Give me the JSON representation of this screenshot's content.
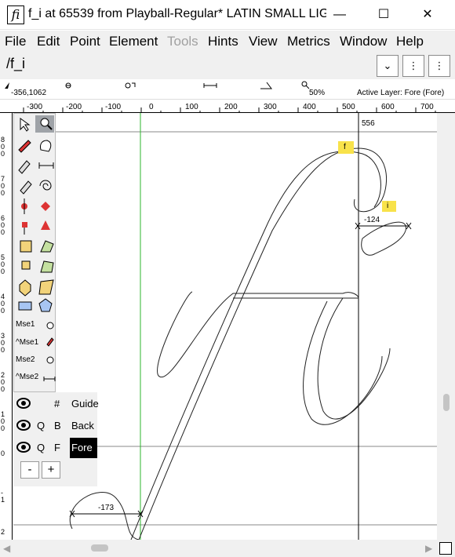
{
  "window": {
    "title": "f_i at 65539 from Playball-Regular* LATIN SMALL LIG...",
    "app_icon_glyph": "fi",
    "minimize": "—",
    "maximize": "☐",
    "close": "✕"
  },
  "menu": [
    "File",
    "Edit",
    "Point",
    "Element",
    "Tools",
    "Hints",
    "View",
    "Metrics",
    "Window",
    "Help"
  ],
  "menu_disabled": [
    "Tools"
  ],
  "glyph_bar": {
    "name": "/f_i",
    "dropdown": "⌄",
    "btn2": "⋮",
    "btn3": "⋮"
  },
  "info_bar": {
    "coords": "-356,1062",
    "zoom": "50%",
    "active_layer": "Active Layer: Fore (Fore)"
  },
  "ruler_top": [
    "-300",
    "-200",
    "-100",
    "0",
    "100",
    "200",
    "300",
    "400",
    "500",
    "600",
    "700"
  ],
  "ruler_left": [
    "8\n0\n0",
    "7\n0\n0",
    "6\n0\n0",
    "5\n0\n0",
    "4\n0\n0",
    "3\n0\n0",
    "2\n0\n0",
    "1\n0\n0",
    "0",
    "-\n1",
    "2"
  ],
  "canvas": {
    "advance_label": "556",
    "glyph_label_f": "f",
    "glyph_label_i": "i",
    "measure_i": "-124",
    "measure_f": "-173"
  },
  "mouse_labels": [
    "Mse1",
    "^Mse1",
    "Mse2",
    "^Mse2"
  ],
  "layers": [
    {
      "q": "",
      "letter": "#",
      "name": "Guide"
    },
    {
      "q": "Q",
      "letter": "B",
      "name": "Back"
    },
    {
      "q": "Q",
      "letter": "F",
      "name": "Fore"
    }
  ],
  "layer_buttons": {
    "minus": "-",
    "plus": "+"
  }
}
